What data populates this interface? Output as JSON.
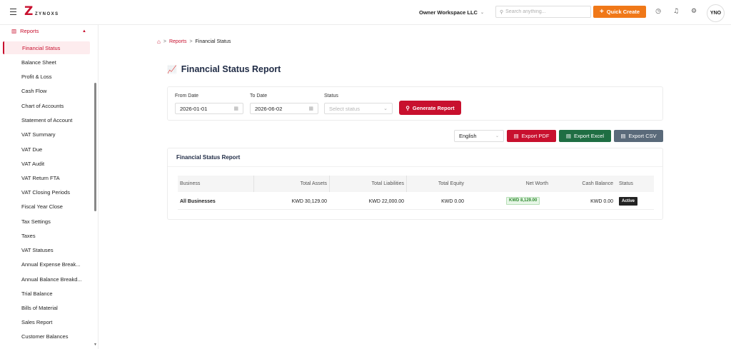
{
  "topbar": {
    "logo_text": "ZYNOXS",
    "workspace": "Owner Workspace LLC",
    "search_placeholder": "Search anything...",
    "quick_create": "Quick Create",
    "avatar_initials": "YNO"
  },
  "sidebar": {
    "section_label": "Reports",
    "active_item": "Financial Status",
    "items": [
      "Balance Sheet",
      "Profit & Loss",
      "Cash Flow",
      "Chart of Accounts",
      "Statement of Account",
      "VAT Summary",
      "VAT Due",
      "VAT Audit",
      "VAT Return FTA",
      "VAT Closing Periods",
      "Fiscal Year Close",
      "Tax Settings",
      "Taxes",
      "VAT Statuses",
      "Annual Expense Break...",
      "Annual Balance Breakd...",
      "Trial Balance",
      "Bills of Material",
      "Sales Report",
      "Customer Balances"
    ]
  },
  "breadcrumb": {
    "parent": "Reports",
    "current": "Financial Status"
  },
  "page": {
    "title": "Financial Status Report"
  },
  "filters": {
    "from_label": "From Date",
    "from_value": "2026-01-01",
    "to_label": "To Date",
    "to_value": "2026-06-02",
    "status_label": "Status",
    "status_placeholder": "Select status",
    "generate_label": "Generate Report"
  },
  "export": {
    "language": "English",
    "pdf_label": "Export PDF",
    "excel_label": "Export Excel",
    "csv_label": "Export CSV"
  },
  "report": {
    "card_title": "Financial Status Report",
    "columns": [
      "Business",
      "Total Assets",
      "Total Liabilities",
      "Total Equity",
      "Net Worth",
      "Cash Balance",
      "Status"
    ],
    "rows": [
      {
        "business": "All Businesses",
        "total_assets": "KWD 30,129.00",
        "total_liabilities": "KWD 22,000.00",
        "total_equity": "KWD 0.00",
        "net_worth": "KWD 8,129.00",
        "cash_balance": "KWD 0.00",
        "status": "Active"
      }
    ]
  },
  "colors": {
    "brand_red": "#c8102e",
    "quick_create_orange": "#f07818",
    "excel_green": "#1f6e43",
    "csv_slate": "#5a6a7a"
  }
}
